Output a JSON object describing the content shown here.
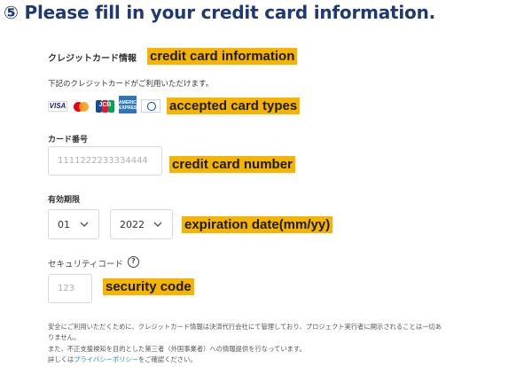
{
  "heading": "⑤ Please fill in your credit card information.",
  "section": {
    "title_ja": "クレジットカード情報",
    "title_en": "credit card information",
    "accepted_ja": "下記のクレジットカードがご利用いただけます。",
    "accepted_en": "accepted card types"
  },
  "cards": {
    "visa": "VISA",
    "jcb": "JCB",
    "amex": "AMERICAN EXPRESS",
    "icons": [
      "visa-icon",
      "mastercard-icon",
      "jcb-icon",
      "amex-icon",
      "diners-club-icon"
    ]
  },
  "card_number": {
    "label_ja": "カード番号",
    "placeholder": "1111222233334444",
    "label_en": "credit card number"
  },
  "expiration": {
    "label_ja": "有効期限",
    "month": "01",
    "year": "2022",
    "label_en": "expiration date(mm/yy)"
  },
  "security": {
    "label_ja": "セキュリティコード",
    "help": "?",
    "placeholder": "123",
    "label_en": "security code"
  },
  "notes": {
    "line1": "安全にご利用いただくために、クレジットカード情報は決済代行会社にて管理しており、プロジェクト実行者に開示されることは一切あ",
    "line2": "りません。",
    "line3": "また、不正支援検知を目的とした第三者（外国事業者）への情報提供を行なっています。",
    "line4_pre": "詳しくは",
    "line4_link": "プライバシーポリシー",
    "line4_post": "をご確認ください。"
  },
  "colors": {
    "heading": "#1f3a73",
    "highlight": "#f5b400",
    "link": "#2a7bd1"
  }
}
